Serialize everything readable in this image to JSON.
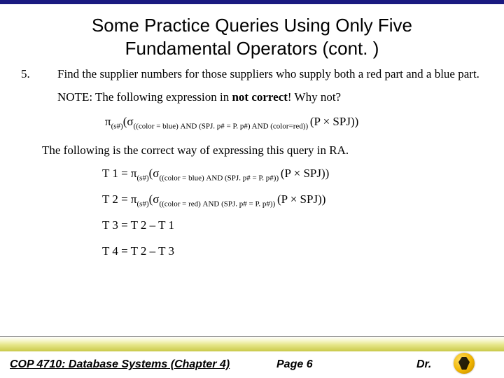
{
  "title_line1": "Some Practice Queries Using Only Five",
  "title_line2": "Fundamental Operators (cont. )",
  "item_num": "5.",
  "item_text": "Find the supplier numbers for those suppliers who supply both a red part and a blue part.",
  "note_prefix": "NOTE:  The following expression in ",
  "note_bold": "not correct",
  "note_suffix": "!  Why not?",
  "wrong_expr": {
    "pi": "π",
    "pi_sub": "(s#)",
    "sigma": "(σ",
    "sigma_sub": "((color = blue) AND (SPJ. p# = P. p#) AND (color=red)) ",
    "tail": "(P × SPJ))"
  },
  "correct_intro": "The following is the correct way of expressing this query in RA.",
  "t1": {
    "label": "T 1 = ",
    "pi": "π",
    "pi_sub": "(s#)",
    "sigma": "(σ",
    "sigma_sub": "((color = blue) AND (SPJ. p# = P. p#)) ",
    "tail": "(P × SPJ))"
  },
  "t2": {
    "label": "T 2 = ",
    "pi": "π",
    "pi_sub": "(s#)",
    "sigma": "(σ",
    "sigma_sub": "((color = red) AND (SPJ. p# = P. p#)) ",
    "tail": "(P × SPJ))"
  },
  "t3": "T 3 = T 2 – T 1",
  "t4": "T 4 = T 2 – T 3",
  "footer": {
    "left": "COP 4710: Database Systems  (Chapter 4)",
    "page": "Page 6",
    "right": "Dr."
  }
}
